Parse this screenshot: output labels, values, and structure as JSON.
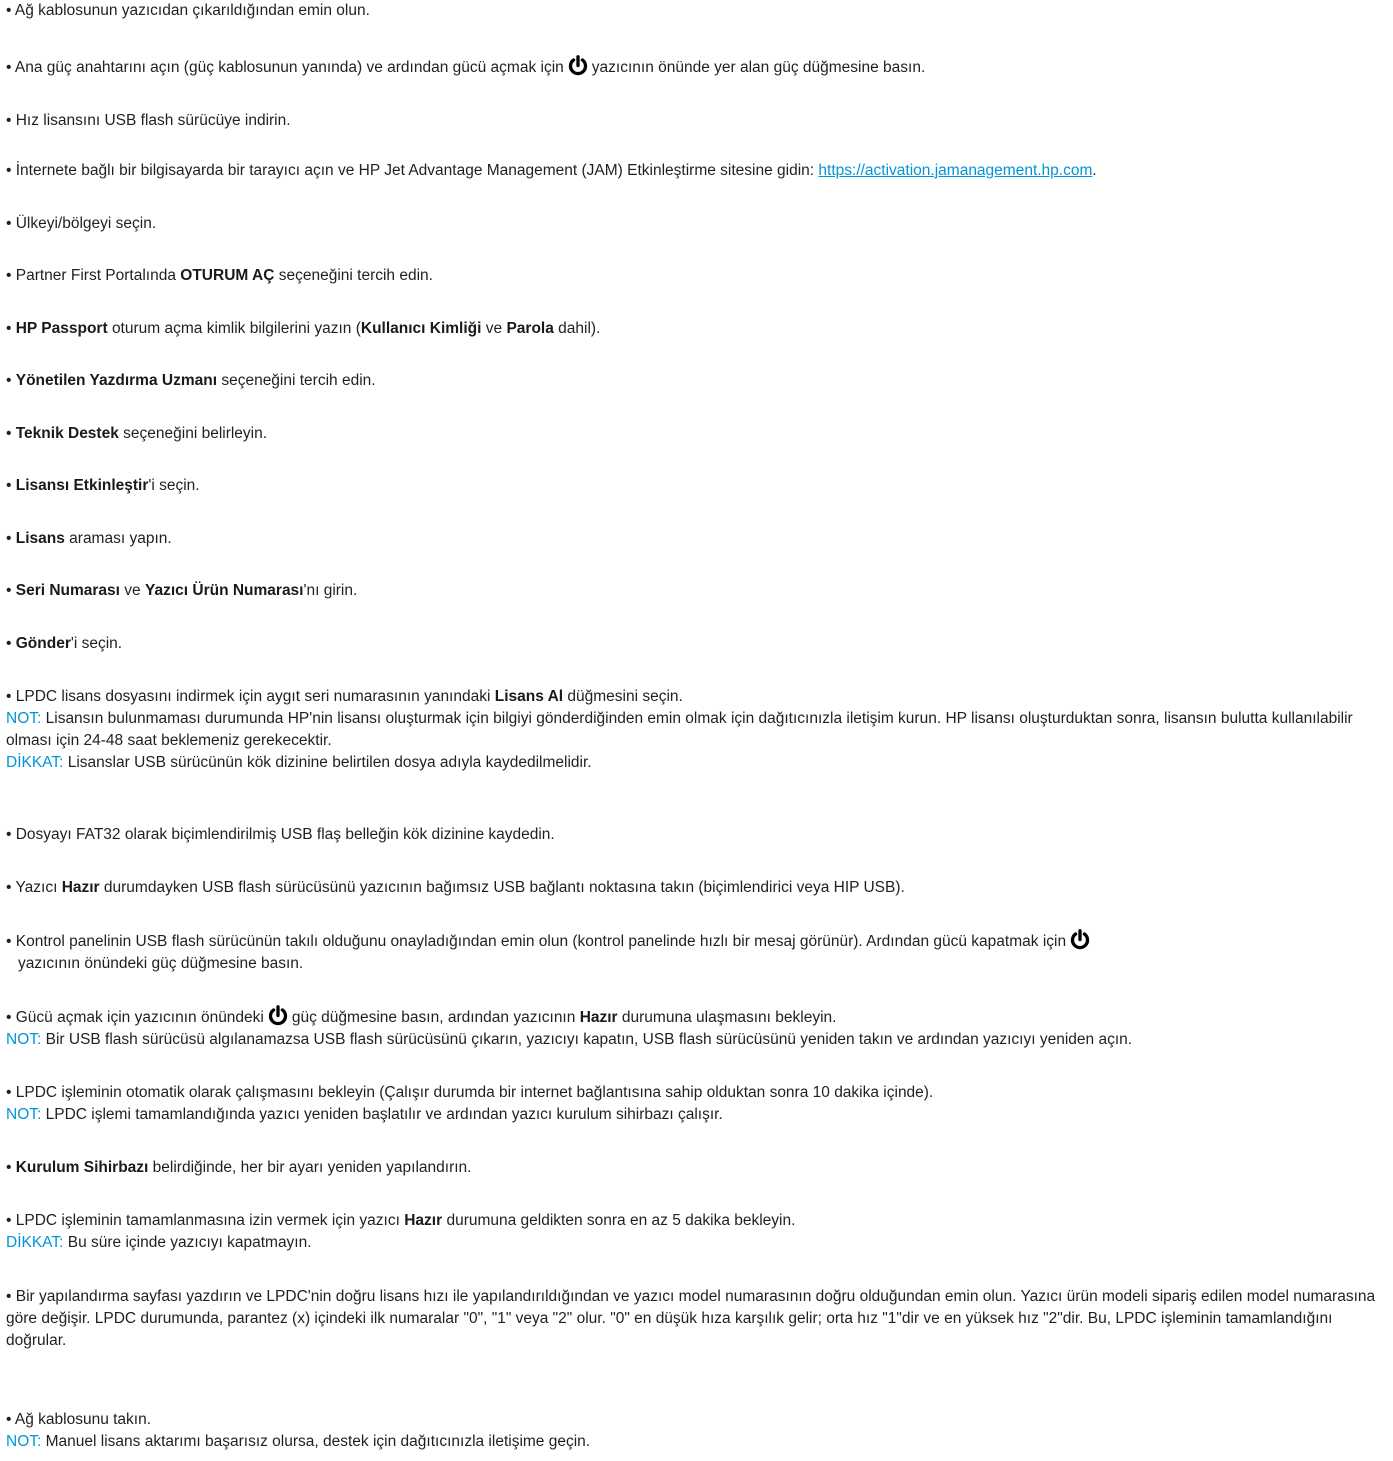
{
  "text": {
    "s1": "Ağ kablosunun yazıcıdan çıkarıldığından emin olun.",
    "s2a": "Ana güç anahtarını açın (güç kablosunun yanında) ve ardından gücü açmak için",
    "s2b": "yazıcının önünde yer alan güç düğmesine basın.",
    "s3": "Hız lisansını USB flash sürücüye indirin.",
    "s4": "İnternete bağlı bir bilgisayarda bir tarayıcı açın ve HP Jet Advantage Management (JAM) Etkinleştirme sitesine gidin:",
    "s4_link": "https://activation.jamanagement.hp.com",
    "s5": "Ülkeyi/bölgeyi seçin.",
    "s6a": "Partner First Portalında",
    "s6b": "OTURUM AÇ",
    "s6c": "seçeneğini tercih edin.",
    "s7a": "HP Passport",
    "s7b": "oturum açma kimlik bilgilerini yazın (",
    "s7c": "Kullanıcı Kimliği",
    "s7d": "ve",
    "s7e": "Parola",
    "s7f": "dahil).",
    "s8a": "Yönetilen Yazdırma Uzmanı",
    "s8b": "seçeneğini tercih edin.",
    "s9a": "Teknik Destek",
    "s9b": "seçeneğini belirleyin.",
    "s10a": "Lisansı Etkinleştir",
    "s10b": "'i seçin.",
    "s11a": "Lisans",
    "s11b": "araması yapın.",
    "s12a": "Seri Numarası",
    "s12b": "ve",
    "s12c": "Yazıcı Ürün Numarası",
    "s12d": "'nı girin.",
    "s13a": "Gönder",
    "s13b": "'i seçin.",
    "s14a": "LPDC lisans dosyasını indirmek için aygıt seri numarasının yanındaki",
    "s14b": "Lisans Al",
    "s14c": "düğmesini seçin.",
    "s14_note_label": "NOT:",
    "s14_note": "Lisansın bulunmaması durumunda HP'nin lisansı oluşturmak için bilgiyi gönderdiğinden emin olmak için dağıtıcınızla iletişim kurun. HP lisansı oluşturduktan sonra, lisansın bulutta kullanılabilir olması için 24-48 saat beklemeniz gerekecektir.",
    "s14_caution_label": "DİKKAT:",
    "s14_caution": "Lisanslar USB sürücünün kök dizinine belirtilen dosya adıyla kaydedilmelidir.",
    "s15": "Dosyayı FAT32 olarak biçimlendirilmiş USB flaş belleğin kök dizinine kaydedin.",
    "s16a": "Yazıcı",
    "s16b": "Hazır",
    "s16c": "durumdayken USB flash sürücüsünü yazıcının bağımsız USB bağlantı noktasına takın (biçimlendirici veya HIP USB).",
    "s17a": "Kontrol panelinin USB flash sürücünün takılı olduğunu onayladığından emin olun (kontrol panelinde hızlı bir mesaj görünür). Ardından gücü kapatmak için",
    "s17b": "yazıcının önündeki güç düğmesine basın.",
    "s18a": "Gücü açmak için yazıcının önündeki",
    "s18b": "güç düğmesine basın, ardından yazıcının",
    "s18c": "Hazır",
    "s18d": "durumuna ulaşmasını bekleyin.",
    "s18_note_label": "NOT:",
    "s18_note": "Bir USB flash sürücüsü algılanamazsa USB flash sürücüsünü çıkarın, yazıcıyı kapatın, USB flash sürücüsünü yeniden takın ve ardından yazıcıyı yeniden açın.",
    "s19": "LPDC işleminin otomatik olarak çalışmasını bekleyin (Çalışır durumda bir internet bağlantısına sahip olduktan sonra 10 dakika içinde).",
    "s19_note_label": "NOT:",
    "s19_note": "LPDC işlemi tamamlandığında yazıcı yeniden başlatılır ve ardından yazıcı kurulum sihirbazı çalışır.",
    "s20a": "Kurulum Sihirbazı",
    "s20b": "belirdiğinde, her bir ayarı yeniden yapılandırın.",
    "s21a": "LPDC işleminin tamamlanmasına izin vermek için yazıcı",
    "s21b": "Hazır",
    "s21c": "durumuna geldikten sonra en az 5 dakika bekleyin.",
    "s21_caution_label": "DİKKAT:",
    "s21_caution": "Bu süre içinde yazıcıyı kapatmayın.",
    "s22": "Bir yapılandırma sayfası yazdırın ve LPDC'nin doğru lisans hızı ile yapılandırıldığından ve yazıcı model numarasının doğru olduğundan emin olun. Yazıcı ürün modeli sipariş edilen model numarasına göre değişir. LPDC durumunda, parantez (x) içindeki ilk numaralar \"0\", \"1\" veya \"2\" olur. \"0\" en düşük hıza karşılık gelir; orta hız \"1\"dir ve en yüksek hız \"2\"dir. Bu, LPDC işleminin tamamlandığını doğrular.",
    "s23": "Ağ kablosunu takın.",
    "s23_note_label": "NOT:",
    "s23_note": "Manuel lisans aktarımı başarısız olursa, destek için dağıtıcınızla iletişime geçin."
  },
  "icons": {
    "power": "power-icon"
  },
  "colors": {
    "accent": "#0096d6",
    "text": "#231f20"
  }
}
